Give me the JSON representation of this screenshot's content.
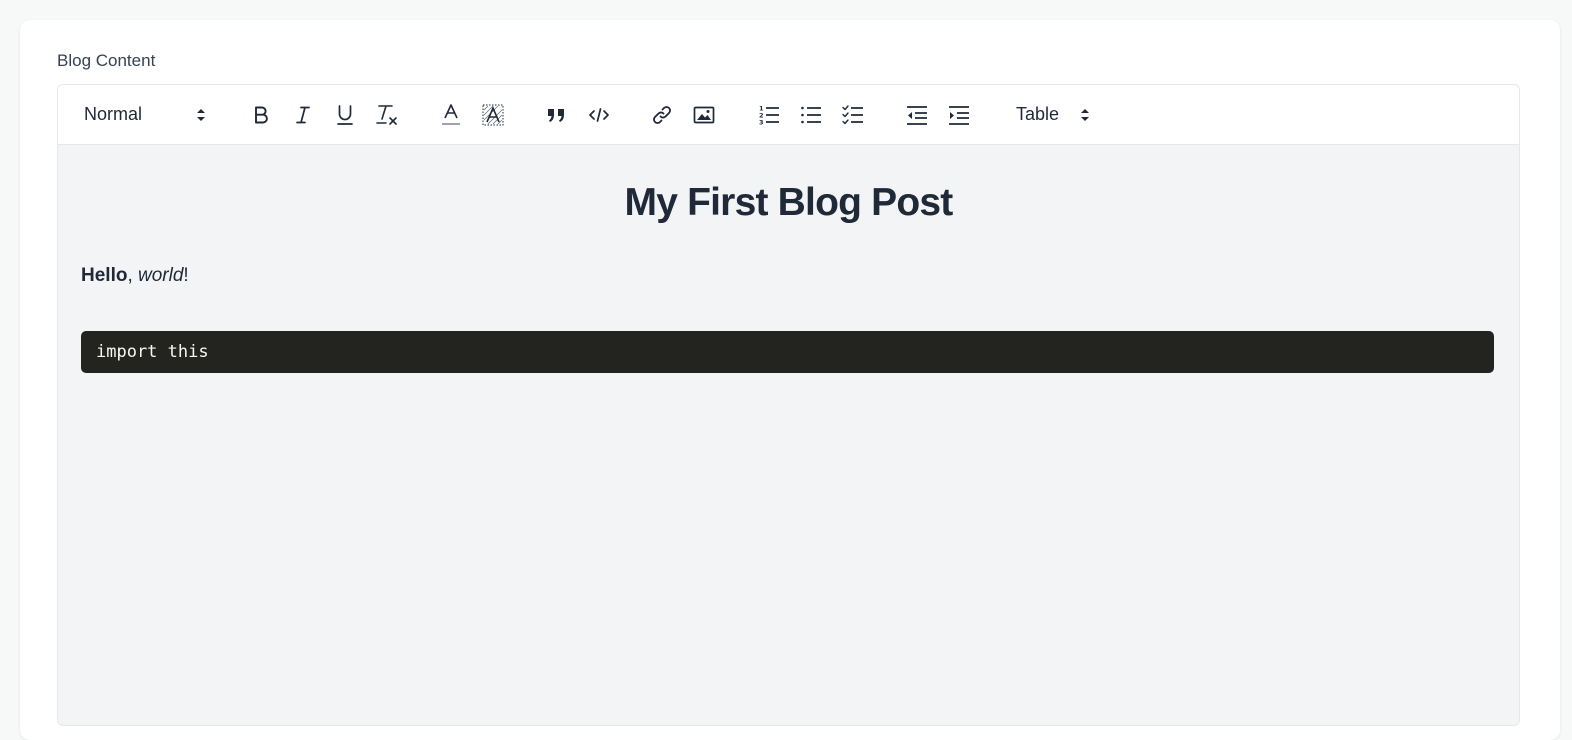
{
  "field": {
    "label": "Blog Content"
  },
  "toolbar": {
    "header_select": {
      "value": "Normal"
    },
    "table_select": {
      "value": "Table"
    },
    "buttons": [
      "bold",
      "italic",
      "underline",
      "clean",
      "color",
      "background",
      "blockquote",
      "code-block",
      "link",
      "image",
      "list-ordered",
      "list-bullet",
      "list-check",
      "indent-decrease",
      "indent-increase"
    ]
  },
  "document": {
    "title": "My First Blog Post",
    "paragraph": {
      "bold": "Hello",
      "sep": ", ",
      "italic": "world",
      "end": "!"
    },
    "code": "import this"
  },
  "colors": {
    "code_bg": "#23241f",
    "editor_bg": "#f3f4f6",
    "text": "#1f2937"
  }
}
